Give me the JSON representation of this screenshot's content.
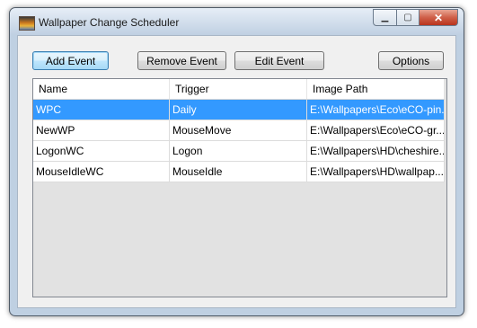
{
  "window": {
    "title": "Wallpaper Change Scheduler",
    "caption": {
      "minimize": "▁",
      "maximize": "▢",
      "close": "✕"
    }
  },
  "toolbar": {
    "add_event": "Add Event",
    "remove_event": "Remove Event",
    "edit_event": "Edit Event",
    "options": "Options"
  },
  "table": {
    "columns": [
      "Name",
      "Trigger",
      "Image Path"
    ],
    "rows": [
      {
        "name": "WPC",
        "trigger": "Daily",
        "path": "E:\\Wallpapers\\Eco\\eCO-pin...",
        "selected": true
      },
      {
        "name": "NewWP",
        "trigger": "MouseMove",
        "path": "E:\\Wallpapers\\Eco\\eCO-gr...",
        "selected": false
      },
      {
        "name": "LogonWC",
        "trigger": "Logon",
        "path": "E:\\Wallpapers\\HD\\cheshire...",
        "selected": false
      },
      {
        "name": "MouseIdleWC",
        "trigger": "MouseIdle",
        "path": "E:\\Wallpapers\\HD\\wallpap...",
        "selected": false
      }
    ]
  },
  "colors": {
    "selection": "#3399ff",
    "close_button": "#c9462f"
  },
  "icons": {
    "app": "wallpaper-app-icon"
  }
}
